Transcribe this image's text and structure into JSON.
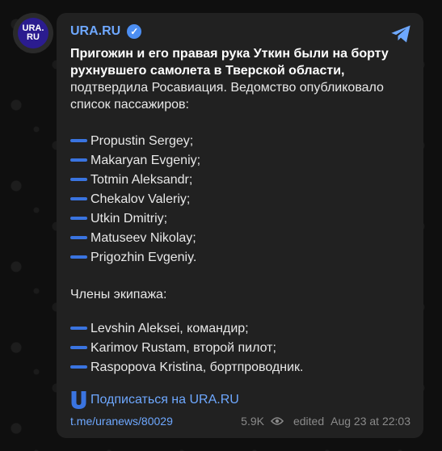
{
  "avatar": {
    "line1": "URA.",
    "line2": "RU"
  },
  "channel": {
    "name": "URA.RU"
  },
  "post": {
    "headline": "Пригожин и его правая рука Уткин были на борту рухнувшего самолета в Тверской области,",
    "body": " подтвердила Росавиация. Ведомство опубликовало список пассажиров:",
    "passengers": [
      "Propustin Sergey;",
      "Makaryan Evgeniy;",
      "Totmin Aleksandr;",
      "Chekalov Valeriy;",
      "Utkin Dmitriy;",
      "Matuseev Nikolay;",
      "Prigozhin Evgeniy."
    ],
    "crew_label": "Члены экипажа:",
    "crew": [
      "Levshin Aleksei, командир;",
      "Karimov Rustam, второй пилот;",
      "Raspopova Kristina, бортпроводник."
    ],
    "subscribe": "Подписаться на URA.RU"
  },
  "footer": {
    "link": "t.me/uranews/80029",
    "views": "5.9K",
    "edited": "edited",
    "datetime": "Aug 23 at 22:03"
  },
  "colors": {
    "accent": "#6ea8ff",
    "dash": "#3a74e0",
    "bubble": "#212121"
  }
}
